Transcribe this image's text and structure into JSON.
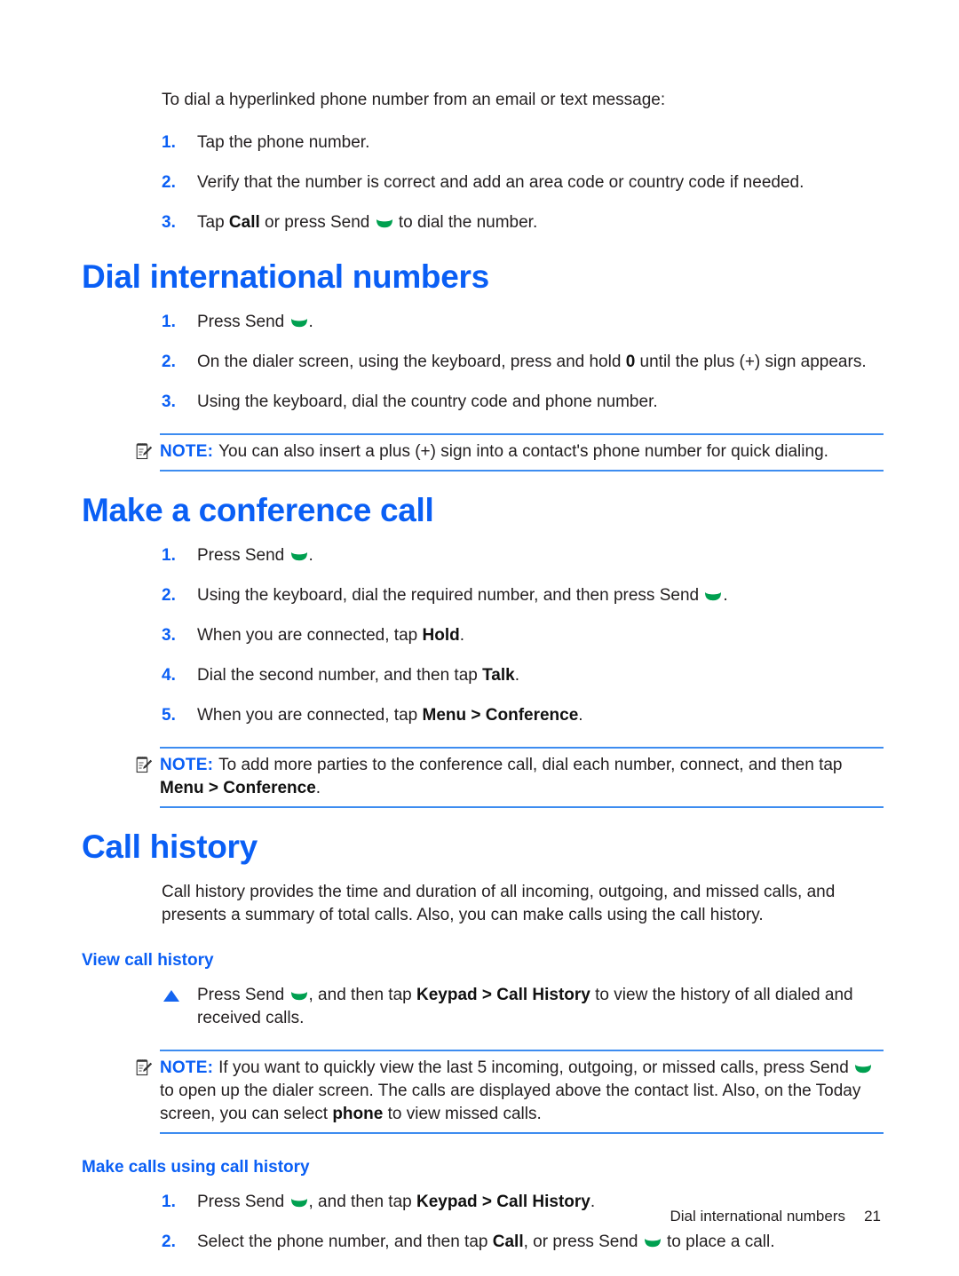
{
  "document": {
    "type": "user-guide-page",
    "accent_blue": "#0a5ff5",
    "rule_blue": "#3d8cf0",
    "send_icon_green": "#00a050",
    "body_text_color": "#231f20"
  },
  "intro": {
    "text": "To dial a hyperlinked phone number from an email or text message:"
  },
  "intro_steps": [
    {
      "marker": "1.",
      "text": "Tap the phone number."
    },
    {
      "marker": "2.",
      "text": "Verify that the number is correct and add an area code or country code if needed."
    },
    {
      "marker": "3.",
      "pre": "Tap ",
      "bold1": "Call",
      "mid": " or press Send ",
      "icon": "send-icon",
      "post": " to dial the number."
    }
  ],
  "sections": [
    {
      "id": "dial-international-numbers",
      "title": "Dial international numbers",
      "steps": [
        {
          "marker": "1.",
          "pre": "Press Send ",
          "icon": "send-icon",
          "post": "."
        },
        {
          "marker": "2.",
          "pre": "On the dialer screen, using the keyboard, press and hold ",
          "bold1": "0",
          "post": " until the plus (+) sign appears."
        },
        {
          "marker": "3.",
          "text": "Using the keyboard, dial the country code and phone number."
        }
      ],
      "note": {
        "label": "NOTE:",
        "text": "You can also insert a plus (+) sign into a contact's phone number for quick dialing."
      }
    },
    {
      "id": "make-a-conference-call",
      "title": "Make a conference call",
      "steps": [
        {
          "marker": "1.",
          "pre": "Press Send ",
          "icon": "send-icon",
          "post": "."
        },
        {
          "marker": "2.",
          "pre": "Using the keyboard, dial the required number, and then press Send ",
          "icon": "send-icon",
          "post": "."
        },
        {
          "marker": "3.",
          "pre": "When you are connected, tap ",
          "bold1": "Hold",
          "post": "."
        },
        {
          "marker": "4.",
          "pre": "Dial the second number, and then tap ",
          "bold1": "Talk",
          "post": "."
        },
        {
          "marker": "5.",
          "pre": "When you are connected, tap ",
          "bold1": "Menu > Conference",
          "post": "."
        }
      ],
      "note": {
        "label": "NOTE:",
        "pre": "To add more parties to the conference call, dial each number, connect, and then tap ",
        "bold1": "Menu > Conference",
        "post": "."
      }
    },
    {
      "id": "call-history",
      "title": "Call history",
      "paragraph": "Call history provides the time and duration of all incoming, outgoing, and missed calls, and presents a summary of total calls. Also, you can make calls using the call history.",
      "subsections": [
        {
          "id": "view-call-history",
          "title": "View call history",
          "bullet": {
            "marker": "triangle",
            "pre": "Press Send ",
            "icon": "send-icon",
            "mid": ", and then tap ",
            "bold1": "Keypad > Call History",
            "post": " to view the history of all dialed and received calls."
          },
          "note": {
            "label": "NOTE:",
            "pre": "If you want to quickly view the last 5 incoming, outgoing, or missed calls, press Send ",
            "icon": "send-icon",
            "mid": " to open up the dialer screen. The calls are displayed above the contact list. Also, on the Today screen, you can select ",
            "bold1": "phone",
            "post": " to view missed calls."
          }
        },
        {
          "id": "make-calls-using-call-history",
          "title": "Make calls using call history",
          "steps": [
            {
              "marker": "1.",
              "pre": "Press Send ",
              "icon": "send-icon",
              "mid": ", and then tap ",
              "bold1": "Keypad > Call History",
              "post": "."
            },
            {
              "marker": "2.",
              "pre": "Select the phone number, and then tap ",
              "bold1": "Call",
              "mid": ", or press Send ",
              "icon2": "send-icon",
              "post": " to place a call."
            }
          ]
        }
      ]
    }
  ],
  "footer": {
    "breadcrumb": "Dial international numbers",
    "page_number": "21"
  }
}
